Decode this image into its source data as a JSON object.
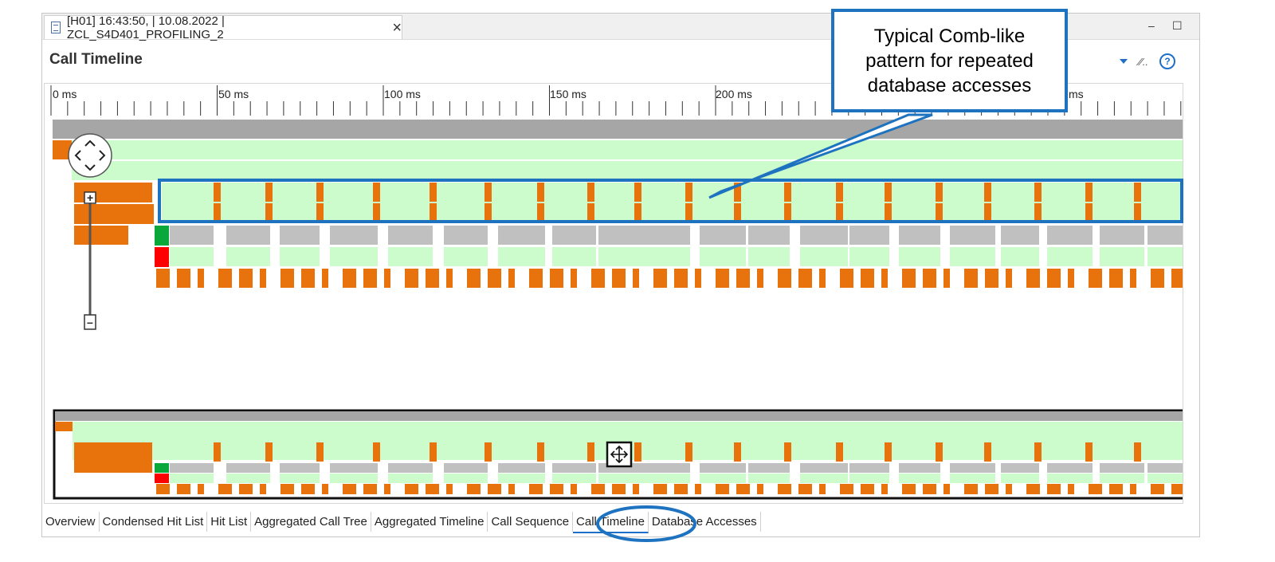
{
  "editor_tab": {
    "title": "[H01] 16:43:50, | 10.08.2022 | ZCL_S4D401_PROFILING_2",
    "close": "×"
  },
  "window": {
    "minimize": "–",
    "maximize": "☐"
  },
  "view_title": "Call Timeline",
  "toolbar": {
    "pin": "⁄⁄..",
    "help": "?"
  },
  "ruler": {
    "labels": [
      "0 ms",
      "50 ms",
      "100 ms",
      "150 ms",
      "200 ms",
      "ms"
    ]
  },
  "zoom": {
    "plus": "+",
    "minus": "–"
  },
  "bottom_tabs": [
    "Overview",
    "Condensed Hit List",
    "Hit List",
    "Aggregated Call Tree",
    "Aggregated Timeline",
    "Call Sequence",
    "Call Timeline",
    "Database Accesses"
  ],
  "active_tab": "Call Timeline",
  "callout": {
    "lines": [
      "Typical Comb-like",
      "pattern for repeated",
      "database accesses"
    ]
  },
  "colors": {
    "orange": "#e8730c",
    "light_green": "#ccfccc",
    "gray": "#a6a6a6",
    "light_gray": "#c0c0c0",
    "green": "#0aa83a",
    "red": "#ff0000",
    "highlight_blue": "#1e73c0"
  }
}
